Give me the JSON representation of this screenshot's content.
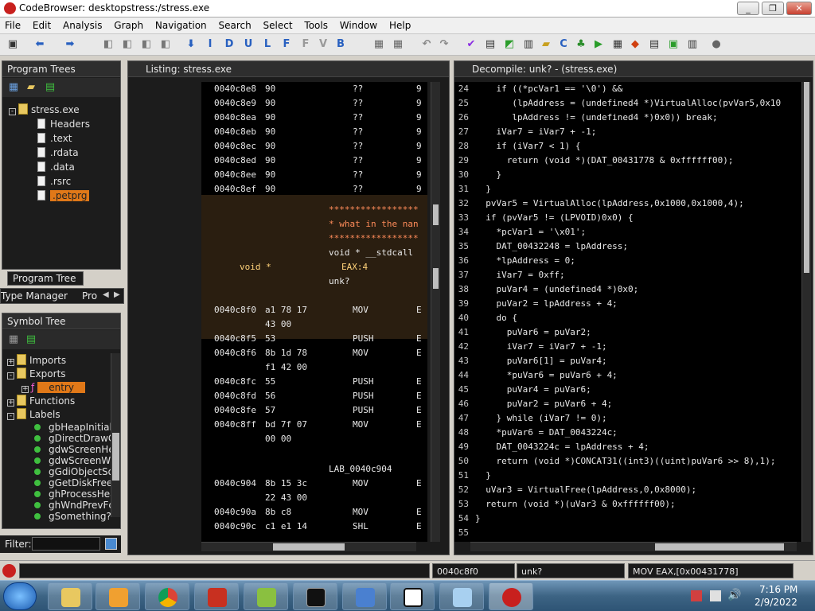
{
  "window": {
    "title": "CodeBrowser: desktopstress:/stress.exe",
    "minimize": "_",
    "maximize": "❐",
    "close": "✕"
  },
  "menu": [
    "File",
    "Edit",
    "Analysis",
    "Graph",
    "Navigation",
    "Search",
    "Select",
    "Tools",
    "Window",
    "Help"
  ],
  "program_trees": {
    "title": "Program Trees",
    "root": "stress.exe",
    "items": [
      "Headers",
      ".text",
      ".rdata",
      ".data",
      ".rsrc",
      ".petprg"
    ],
    "selected": ".petprg",
    "tab": "Program Tree",
    "tab2": "Type Manager",
    "tab3": "Pro"
  },
  "symbol_tree": {
    "title": "Symbol Tree",
    "imports": "Imports",
    "exports": "Exports",
    "entry": "entry",
    "functions": "Functions",
    "labels": "Labels",
    "label_items": [
      "gbHeapInitiali",
      "gDirectDrawC",
      "gdwScreenHe",
      "gdwScreenW",
      "gGdiObjectSo",
      "gGetDiskFree",
      "ghProcessHea",
      "ghWndPrevFc",
      "gSomething?"
    ],
    "filter_label": "Filter:"
  },
  "listing": {
    "title": "Listing:  stress.exe",
    "rows": [
      {
        "addr": "0040c8e8",
        "bytes": "90",
        "mn": "??",
        "op": "9"
      },
      {
        "addr": "0040c8e9",
        "bytes": "90",
        "mn": "??",
        "op": "9"
      },
      {
        "addr": "0040c8ea",
        "bytes": "90",
        "mn": "??",
        "op": "9"
      },
      {
        "addr": "0040c8eb",
        "bytes": "90",
        "mn": "??",
        "op": "9"
      },
      {
        "addr": "0040c8ec",
        "bytes": "90",
        "mn": "??",
        "op": "9"
      },
      {
        "addr": "0040c8ed",
        "bytes": "90",
        "mn": "??",
        "op": "9"
      },
      {
        "addr": "0040c8ee",
        "bytes": "90",
        "mn": "??",
        "op": "9"
      },
      {
        "addr": "0040c8ef",
        "bytes": "90",
        "mn": "??",
        "op": "9"
      }
    ],
    "header_block": {
      "stars1": "*****************",
      "comment": "* what in the nan",
      "stars2": "*****************",
      "signature": "void * __stdcall",
      "ret_type": "void *",
      "ret_reg": "EAX:4",
      "name": "unk?"
    },
    "rows2": [
      {
        "addr": "0040c8f0",
        "bytes": "a1 78 17",
        "mn": "MOV",
        "op": "E"
      },
      {
        "addr": "",
        "bytes": "43 00",
        "mn": "",
        "op": ""
      },
      {
        "addr": "0040c8f5",
        "bytes": "53",
        "mn": "PUSH",
        "op": "E"
      },
      {
        "addr": "0040c8f6",
        "bytes": "8b 1d 78",
        "mn": "MOV",
        "op": "E"
      },
      {
        "addr": "",
        "bytes": "f1 42 00",
        "mn": "",
        "op": ""
      },
      {
        "addr": "0040c8fc",
        "bytes": "55",
        "mn": "PUSH",
        "op": "E"
      },
      {
        "addr": "0040c8fd",
        "bytes": "56",
        "mn": "PUSH",
        "op": "E"
      },
      {
        "addr": "0040c8fe",
        "bytes": "57",
        "mn": "PUSH",
        "op": "E"
      },
      {
        "addr": "0040c8ff",
        "bytes": "bd 7f 07",
        "mn": "MOV",
        "op": "E"
      },
      {
        "addr": "",
        "bytes": "00 00",
        "mn": "",
        "op": ""
      }
    ],
    "label": "LAB_0040c904",
    "rows3": [
      {
        "addr": "0040c904",
        "bytes": "8b 15 3c",
        "mn": "MOV",
        "op": "E"
      },
      {
        "addr": "",
        "bytes": "22 43 00",
        "mn": "",
        "op": ""
      },
      {
        "addr": "0040c90a",
        "bytes": "8b c8",
        "mn": "MOV",
        "op": "E"
      },
      {
        "addr": "0040c90c",
        "bytes": "c1 e1 14",
        "mn": "SHL",
        "op": "E"
      }
    ]
  },
  "decompile": {
    "title": "Decompile: unk? -  (stress.exe)",
    "lines": [
      {
        "n": "24",
        "t": "    if ((*pcVar1 == '\\0') &&"
      },
      {
        "n": "25",
        "t": "       (lpAddress = (undefined4 *)VirtualAlloc(pvVar5,0x10"
      },
      {
        "n": "26",
        "t": "       lpAddress != (undefined4 *)0x0)) break;"
      },
      {
        "n": "27",
        "t": "    iVar7 = iVar7 + -1;"
      },
      {
        "n": "28",
        "t": "    if (iVar7 < 1) {"
      },
      {
        "n": "29",
        "t": "      return (void *)(DAT_00431778 & 0xffffff00);"
      },
      {
        "n": "30",
        "t": "    }"
      },
      {
        "n": "31",
        "t": "  }"
      },
      {
        "n": "32",
        "t": "  pvVar5 = VirtualAlloc(lpAddress,0x1000,0x1000,4);"
      },
      {
        "n": "33",
        "t": "  if (pvVar5 != (LPVOID)0x0) {"
      },
      {
        "n": "34",
        "t": "    *pcVar1 = '\\x01';"
      },
      {
        "n": "35",
        "t": "    DAT_00432248 = lpAddress;"
      },
      {
        "n": "36",
        "t": "    *lpAddress = 0;"
      },
      {
        "n": "37",
        "t": "    iVar7 = 0xff;"
      },
      {
        "n": "38",
        "t": "    puVar4 = (undefined4 *)0x0;"
      },
      {
        "n": "39",
        "t": "    puVar2 = lpAddress + 4;"
      },
      {
        "n": "40",
        "t": "    do {"
      },
      {
        "n": "41",
        "t": "      puVar6 = puVar2;"
      },
      {
        "n": "42",
        "t": "      iVar7 = iVar7 + -1;"
      },
      {
        "n": "43",
        "t": "      puVar6[1] = puVar4;"
      },
      {
        "n": "44",
        "t": "      *puVar6 = puVar6 + 4;"
      },
      {
        "n": "45",
        "t": "      puVar4 = puVar6;"
      },
      {
        "n": "46",
        "t": "      puVar2 = puVar6 + 4;"
      },
      {
        "n": "47",
        "t": "    } while (iVar7 != 0);"
      },
      {
        "n": "48",
        "t": "    *puVar6 = DAT_0043224c;"
      },
      {
        "n": "49",
        "t": "    DAT_0043224c = lpAddress + 4;"
      },
      {
        "n": "50",
        "t": "    return (void *)CONCAT31((int3)((uint)puVar6 >> 8),1);"
      },
      {
        "n": "51",
        "t": "  }"
      },
      {
        "n": "52",
        "t": "  uVar3 = VirtualFree(lpAddress,0,0x8000);"
      },
      {
        "n": "53",
        "t": "  return (void *)(uVar3 & 0xffffff00);"
      },
      {
        "n": "54",
        "t": "}"
      },
      {
        "n": "55",
        "t": ""
      }
    ]
  },
  "status": {
    "address": "0040c8f0",
    "function": "unk?",
    "instruction": "MOV EAX,[0x00431778]"
  },
  "clock": {
    "time": "7:16 PM",
    "date": "2/9/2022"
  },
  "colors": {
    "keyword": "#ff8c5a",
    "func": "#5fd7ff",
    "global": "#ff5fd7",
    "number": "#9fe0a0",
    "type": "#57e3ff",
    "var": "#ffd27a"
  }
}
